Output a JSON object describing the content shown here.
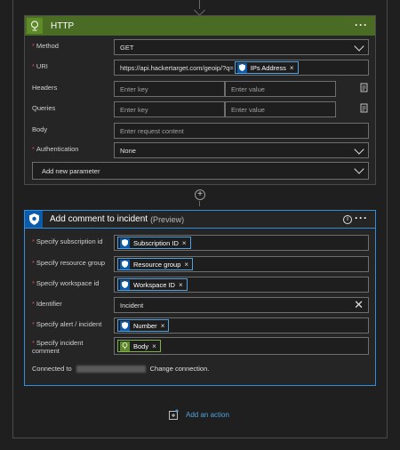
{
  "http": {
    "title": "HTTP",
    "method_label": "Method",
    "method_value": "GET",
    "uri_label": "URI",
    "uri_value": "https://api.hackertarget.com/geoip/?q=",
    "uri_token": "IPs Address",
    "headers_label": "Headers",
    "headers_key_ph": "Enter key",
    "headers_val_ph": "Enter value",
    "queries_label": "Queries",
    "queries_key_ph": "Enter key",
    "queries_val_ph": "Enter value",
    "body_label": "Body",
    "body_ph": "Enter request content",
    "auth_label": "Authentication",
    "auth_value": "None",
    "add_param": "Add new parameter"
  },
  "comment": {
    "title": "Add comment to incident",
    "subtitle": "(Preview)",
    "sub_label": "Specify subscription id",
    "sub_token": "Subscription ID",
    "rg_label": "Specify resource group",
    "rg_token": "Resource group",
    "ws_label": "Specify workspace id",
    "ws_token": "Workspace ID",
    "id_label": "Identifier",
    "id_value": "Incident",
    "alert_label": "Specify alert / incident",
    "alert_token": "Number",
    "comment_label": "Specify incident comment",
    "comment_token": "Body",
    "connected_prefix": "Connected to",
    "change_connection": "Change connection."
  },
  "footer": {
    "add_action": "Add an action"
  },
  "colors": {
    "http_header": "#4a6b23",
    "sentinel_header": "#0b5bab",
    "accent": "#4fa3e0",
    "required": "#e34a4a"
  }
}
